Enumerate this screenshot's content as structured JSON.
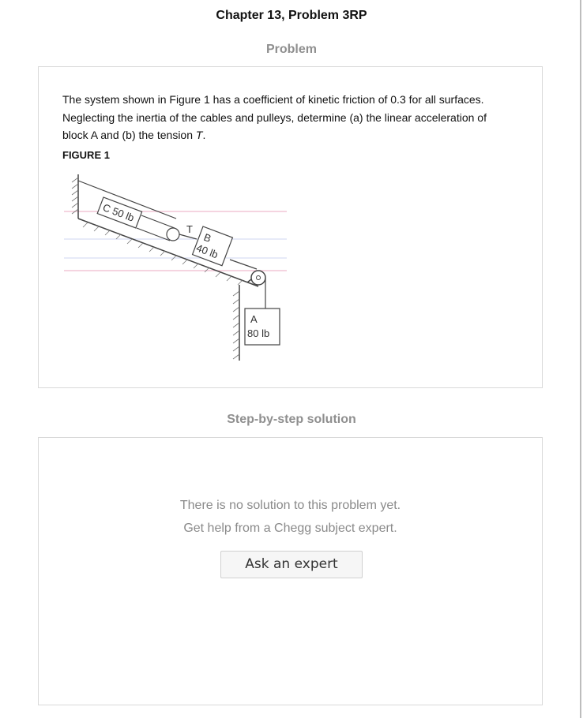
{
  "header": {
    "chapter_title": "Chapter 13, Problem 3RP"
  },
  "problem": {
    "heading": "Problem",
    "text_before_var": "The system shown in Figure 1 has a coefficient of kinetic friction of 0.3 for all surfaces. Neglecting the inertia of the cables and pulleys, determine (a) the linear acceleration of block A and (b) the tension ",
    "text_var": "T",
    "text_after_var": ".",
    "figure_label": "FIGURE 1",
    "figure": {
      "block_c_label": "C 50 lb",
      "block_b_letter": "B",
      "block_b_weight": "40 lb",
      "tension_label": "T",
      "block_a_letter": "A",
      "block_a_weight": "80 lb"
    }
  },
  "solution": {
    "heading": "Step-by-step solution",
    "empty_line_1": "There is no solution to this problem yet.",
    "empty_line_2": "Get help from a Chegg subject expert.",
    "ask_button_label": "Ask an expert"
  }
}
